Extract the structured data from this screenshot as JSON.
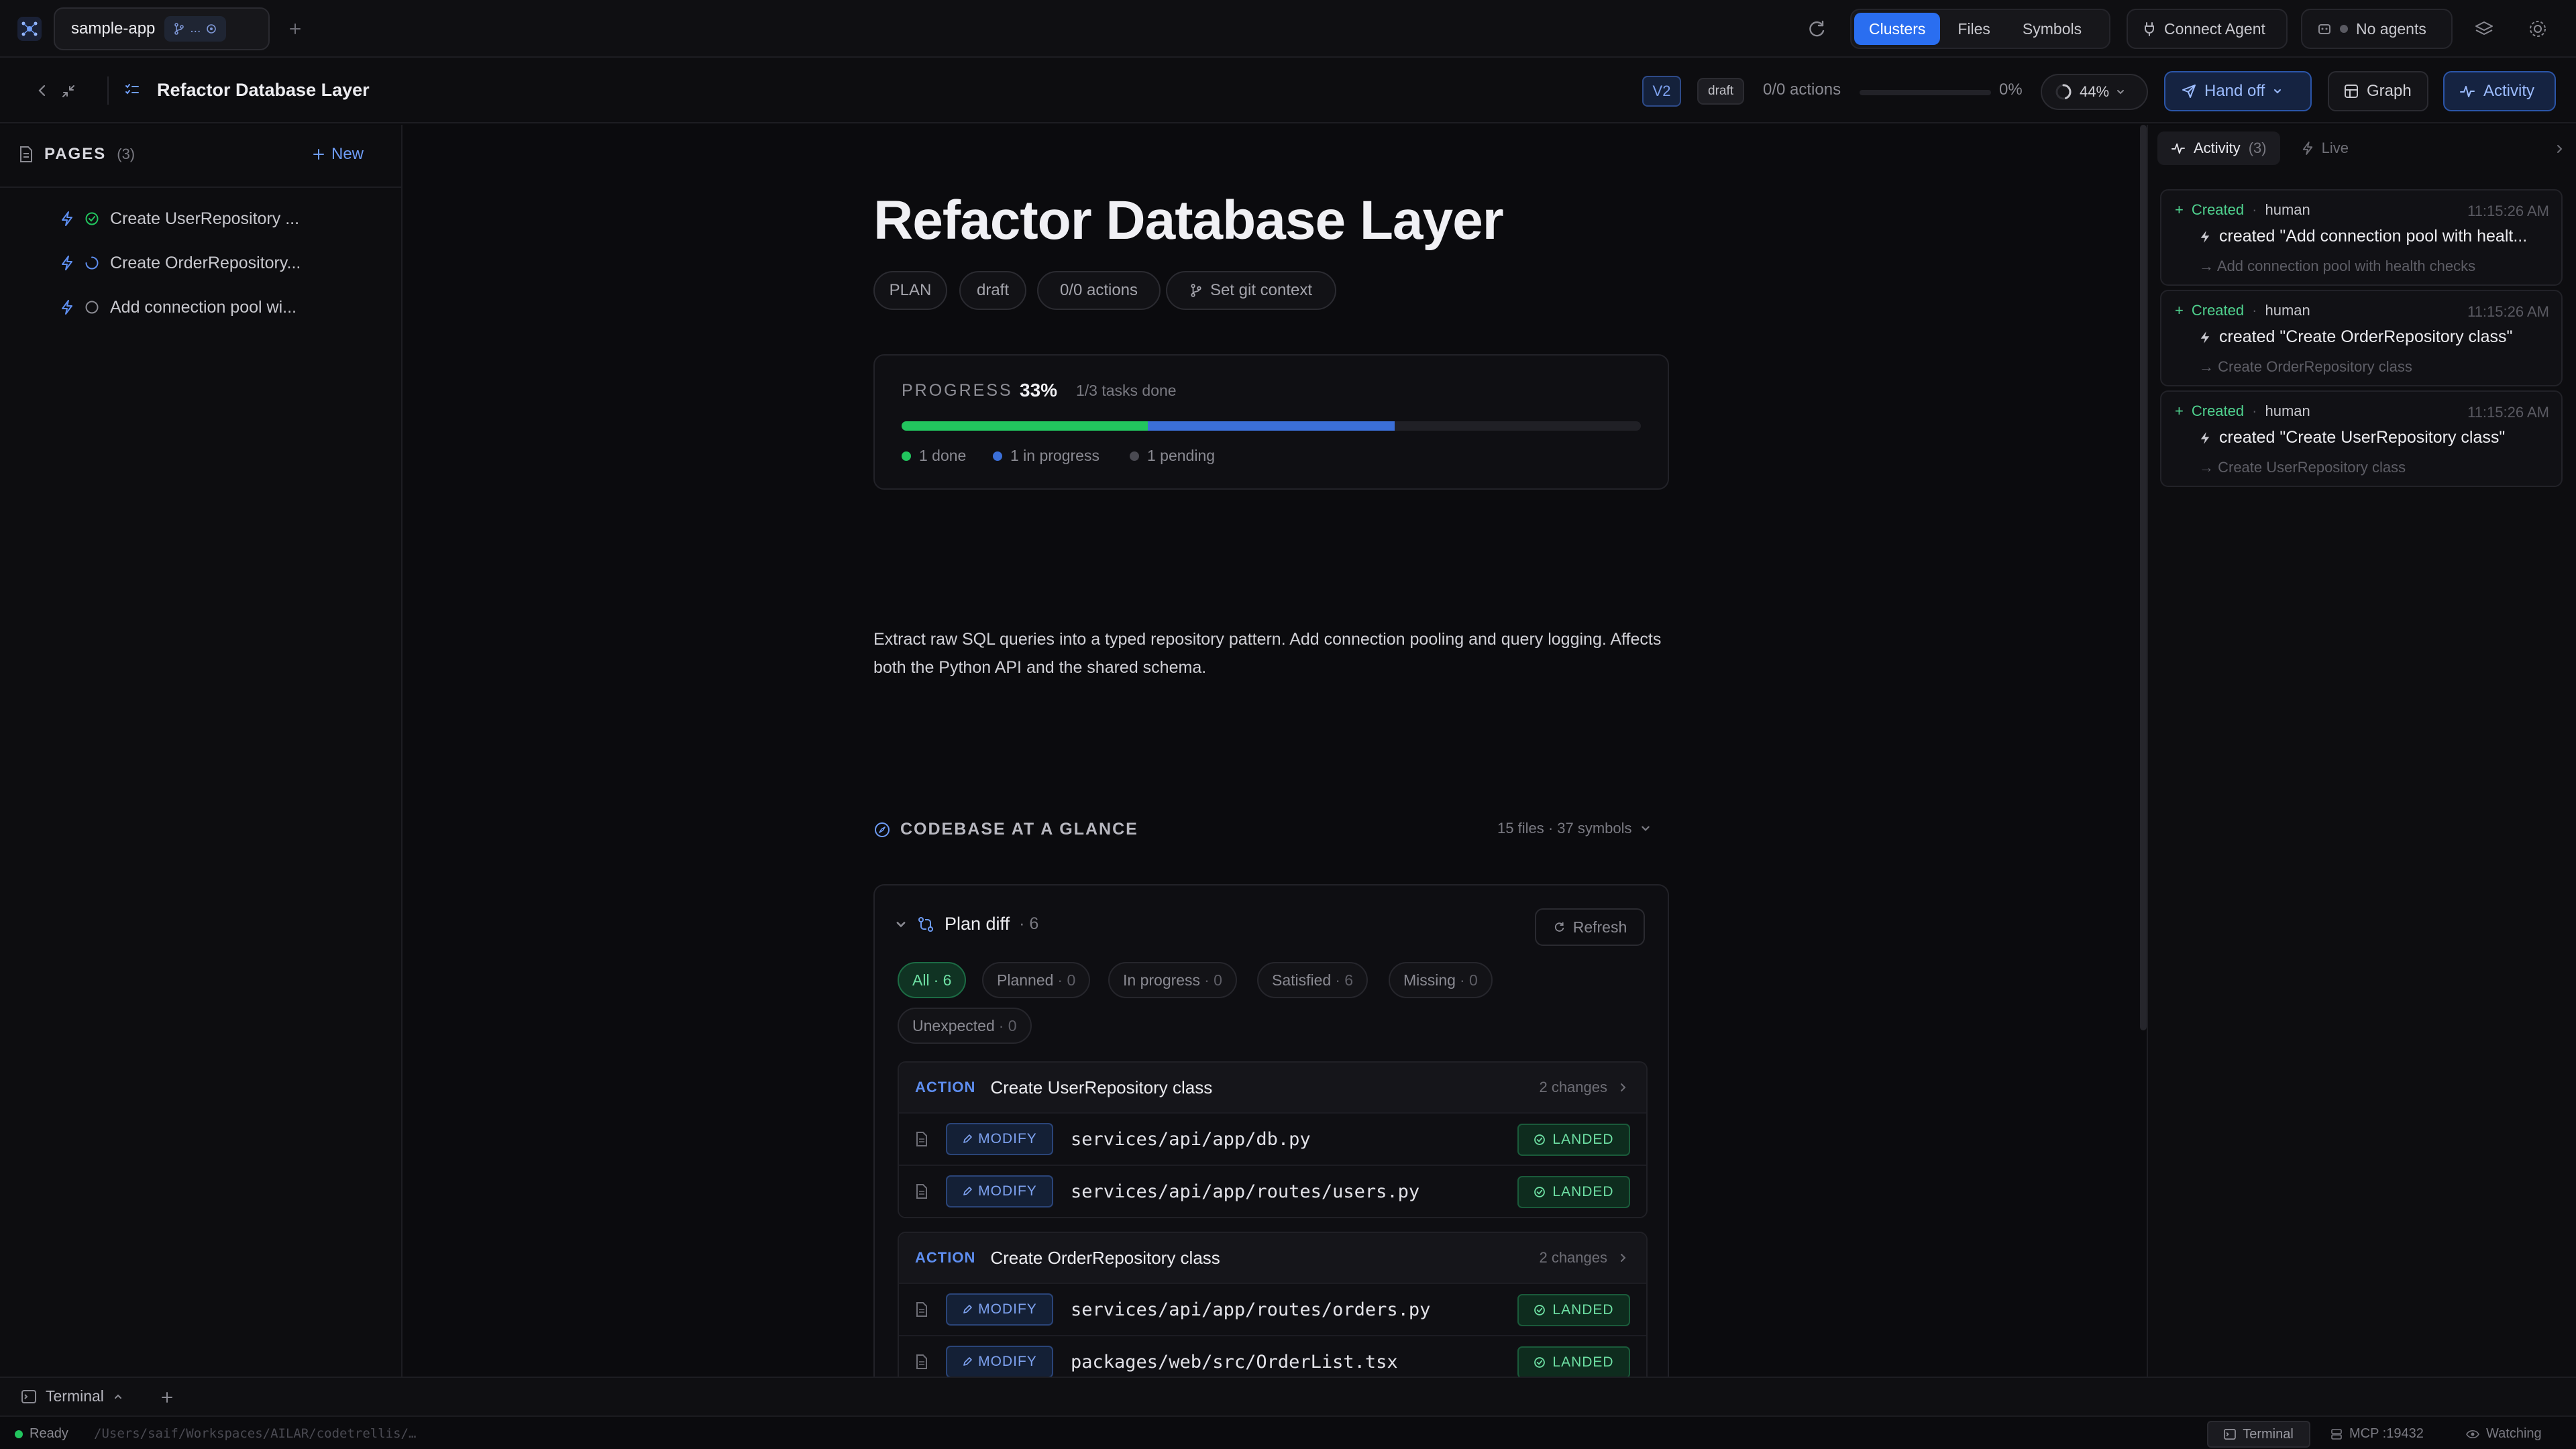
{
  "topbar": {
    "app_name": "sample-app",
    "branch_label": "...",
    "nav": [
      "Clusters",
      "Files",
      "Symbols"
    ],
    "nav_active": "Clusters",
    "connect_agent": "Connect Agent",
    "no_agents": "No agents"
  },
  "subbar": {
    "title": "Refactor Database Layer",
    "version": "V2",
    "status": "draft",
    "actions": "0/0 actions",
    "actions_progress": 0,
    "actions_pct": "0%",
    "context_pct": "44%",
    "context_value": 0.44,
    "handoff": "Hand off",
    "graph": "Graph",
    "activity": "Activity"
  },
  "sidebar": {
    "title": "PAGES",
    "count": "(3)",
    "new_label": "New",
    "items": [
      {
        "label": "Create UserRepository ...",
        "status": "done"
      },
      {
        "label": "Create OrderRepository...",
        "status": "in-progress"
      },
      {
        "label": "Add connection pool wi...",
        "status": "pending"
      }
    ]
  },
  "doc": {
    "title": "Refactor Database Layer",
    "chips": [
      "PLAN",
      "draft",
      "0/0 actions",
      "Set git context"
    ],
    "progress": {
      "label": "PROGRESS",
      "percent": "33%",
      "tasks": "1/3 tasks done",
      "done_fraction": 0.3333,
      "in_progress_fraction": 0.3333,
      "legend": [
        "1 done",
        "1 in progress",
        "1 pending"
      ]
    },
    "description": "Extract raw SQL queries into a typed repository pattern. Add connection pooling and query logging. Affects both the Python API and the shared schema.",
    "glance": {
      "title": "CODEBASE AT A GLANCE",
      "meta": "15 files · 37 symbols"
    },
    "diff": {
      "title": "Plan diff",
      "count": "· 6",
      "refresh": "Refresh",
      "filters": [
        {
          "label": "All",
          "n": "· 6"
        },
        {
          "label": "Planned",
          "n": "· 0"
        },
        {
          "label": "In progress",
          "n": "· 0"
        },
        {
          "label": "Satisfied",
          "n": "· 6"
        },
        {
          "label": "Missing",
          "n": "· 0"
        },
        {
          "label": "Unexpected",
          "n": "· 0"
        }
      ],
      "actions": [
        {
          "tag": "ACTION",
          "name": "Create UserRepository class",
          "changes": "2 changes",
          "files": [
            {
              "op": "MODIFY",
              "path": "services/api/app/db.py",
              "status": "LANDED"
            },
            {
              "op": "MODIFY",
              "path": "services/api/app/routes/users.py",
              "status": "LANDED"
            }
          ]
        },
        {
          "tag": "ACTION",
          "name": "Create OrderRepository class",
          "changes": "2 changes",
          "files": [
            {
              "op": "MODIFY",
              "path": "services/api/app/routes/orders.py",
              "status": "LANDED"
            },
            {
              "op": "MODIFY",
              "path": "packages/web/src/OrderList.tsx",
              "status": "LANDED"
            }
          ]
        }
      ]
    }
  },
  "activity": {
    "tab_activity": "Activity",
    "tab_count": "(3)",
    "tab_live": "Live",
    "entries": [
      {
        "kind": "Created",
        "sep": "·",
        "who": "human",
        "time": "11:15:26 AM",
        "main": "created \"Add connection pool with healt...",
        "sub": "→ Add connection pool with health checks"
      },
      {
        "kind": "Created",
        "sep": "·",
        "who": "human",
        "time": "11:15:26 AM",
        "main": "created \"Create OrderRepository class\"",
        "sub": "→ Create OrderRepository class"
      },
      {
        "kind": "Created",
        "sep": "·",
        "who": "human",
        "time": "11:15:26 AM",
        "main": "created \"Create UserRepository class\"",
        "sub": "→ Create UserRepository class"
      }
    ]
  },
  "bottom": {
    "terminal_tab": "Terminal",
    "ready": "Ready",
    "path": "/Users/saif/Workspaces/AILAR/codetrellis/…",
    "terminal_btn": "Terminal",
    "mcp": "MCP :19432",
    "watching": "Watching"
  },
  "colors": {
    "accent": "#2a6ef0",
    "done": "#22c55e",
    "in_progress": "#3b6fd8",
    "pending": "#4a4a52",
    "created": "#4fd18e"
  }
}
